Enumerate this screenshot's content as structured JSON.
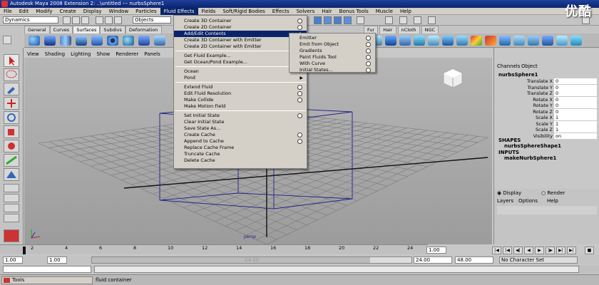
{
  "window": {
    "title": "Autodesk Maya 2008 Extension 2: ..\\untitled    ---    nurbsSphere1"
  },
  "watermark": "优酷",
  "menubar": [
    "File",
    "Edit",
    "Modify",
    "Create",
    "Display",
    "Window",
    "Particles",
    "Fluid Effects",
    "Fields",
    "Soft/Rigid Bodies",
    "Effects",
    "Solvers",
    "Hair",
    "Bonus Tools",
    "Muscle",
    "Help"
  ],
  "status_line": {
    "mode": "Dynamics",
    "select_mode": "Objects"
  },
  "shelf_tabs": [
    "General",
    "Curves",
    "Surfaces",
    "Subdivs",
    "Deformation"
  ],
  "shelf_tabs_right": [
    "Fur",
    "Hair",
    "nCloth",
    "NGC"
  ],
  "panel_menu": [
    "View",
    "Shading",
    "Lighting",
    "Show",
    "Renderer",
    "Panels"
  ],
  "fluid_menu": {
    "items": [
      {
        "label": "Create 3D Container",
        "option": true
      },
      {
        "label": "Create 2D Container",
        "option": true
      },
      {
        "label": "Add/Edit Contents",
        "submenu": true,
        "highlighted": true
      },
      {
        "label": "Create 3D Container with Emitter",
        "option": true
      },
      {
        "label": "Create 2D Container with Emitter",
        "option": true
      },
      {
        "label": "Get Fluid Example..."
      },
      {
        "label": "Get Ocean/Pond Example..."
      },
      {
        "label": "Ocean",
        "submenu": true
      },
      {
        "label": "Pond",
        "submenu": true
      },
      {
        "label": "Extend Fluid",
        "option": true
      },
      {
        "label": "Edit Fluid Resolution",
        "option": true
      },
      {
        "label": "Make Collide",
        "option": true
      },
      {
        "label": "Make Motion Field"
      },
      {
        "label": "Set Initial State",
        "option": true
      },
      {
        "label": "Clear Initial State"
      },
      {
        "label": "Save State As..."
      },
      {
        "label": "Create Cache",
        "option": true
      },
      {
        "label": "Append to Cache",
        "option": true
      },
      {
        "label": "Replace Cache Frame"
      },
      {
        "label": "Truncate Cache"
      },
      {
        "label": "Delete Cache"
      }
    ]
  },
  "submenu": {
    "items": [
      {
        "label": "Emitter",
        "option": true
      },
      {
        "label": "Emit from Object",
        "option": true
      },
      {
        "label": "Gradients",
        "option": true
      },
      {
        "label": "Paint Fluids Tool",
        "option": true
      },
      {
        "label": "With Curve",
        "option": true
      },
      {
        "label": "Initial States...",
        "option": true
      }
    ]
  },
  "channel_box": {
    "tabs": [
      "Channels",
      "Object"
    ],
    "object": "nurbsSphere1",
    "attrs": [
      {
        "name": "Translate X",
        "value": "0"
      },
      {
        "name": "Translate Y",
        "value": "0"
      },
      {
        "name": "Translate Z",
        "value": "0"
      },
      {
        "name": "Rotate X",
        "value": "0"
      },
      {
        "name": "Rotate Y",
        "value": "0"
      },
      {
        "name": "Rotate Z",
        "value": "0"
      },
      {
        "name": "Scale X",
        "value": "1"
      },
      {
        "name": "Scale Y",
        "value": "1"
      },
      {
        "name": "Scale Z",
        "value": "1"
      },
      {
        "name": "Visibility",
        "value": "on"
      }
    ],
    "shapes_label": "SHAPES",
    "shape": "nurbsSphereShape1",
    "inputs_label": "INPUTS",
    "input": "makeNurbSphere1"
  },
  "layer_editor": {
    "display": "Display",
    "render": "Render",
    "menu": [
      "Layers",
      "Options",
      "Help"
    ]
  },
  "viewport": {
    "camera": "persp"
  },
  "timeline": {
    "ticks": [
      "2",
      "4",
      "6",
      "8",
      "10",
      "12",
      "14",
      "16",
      "18",
      "20",
      "22",
      "24"
    ],
    "current": "1.00"
  },
  "range": {
    "start": "1.00",
    "start2": "1.00",
    "mid": "24.00",
    "end": "24.00",
    "end2": "48.00",
    "character": "No Character Set"
  },
  "help_line": {
    "text": "fluid container",
    "tools_label": "Tools"
  }
}
